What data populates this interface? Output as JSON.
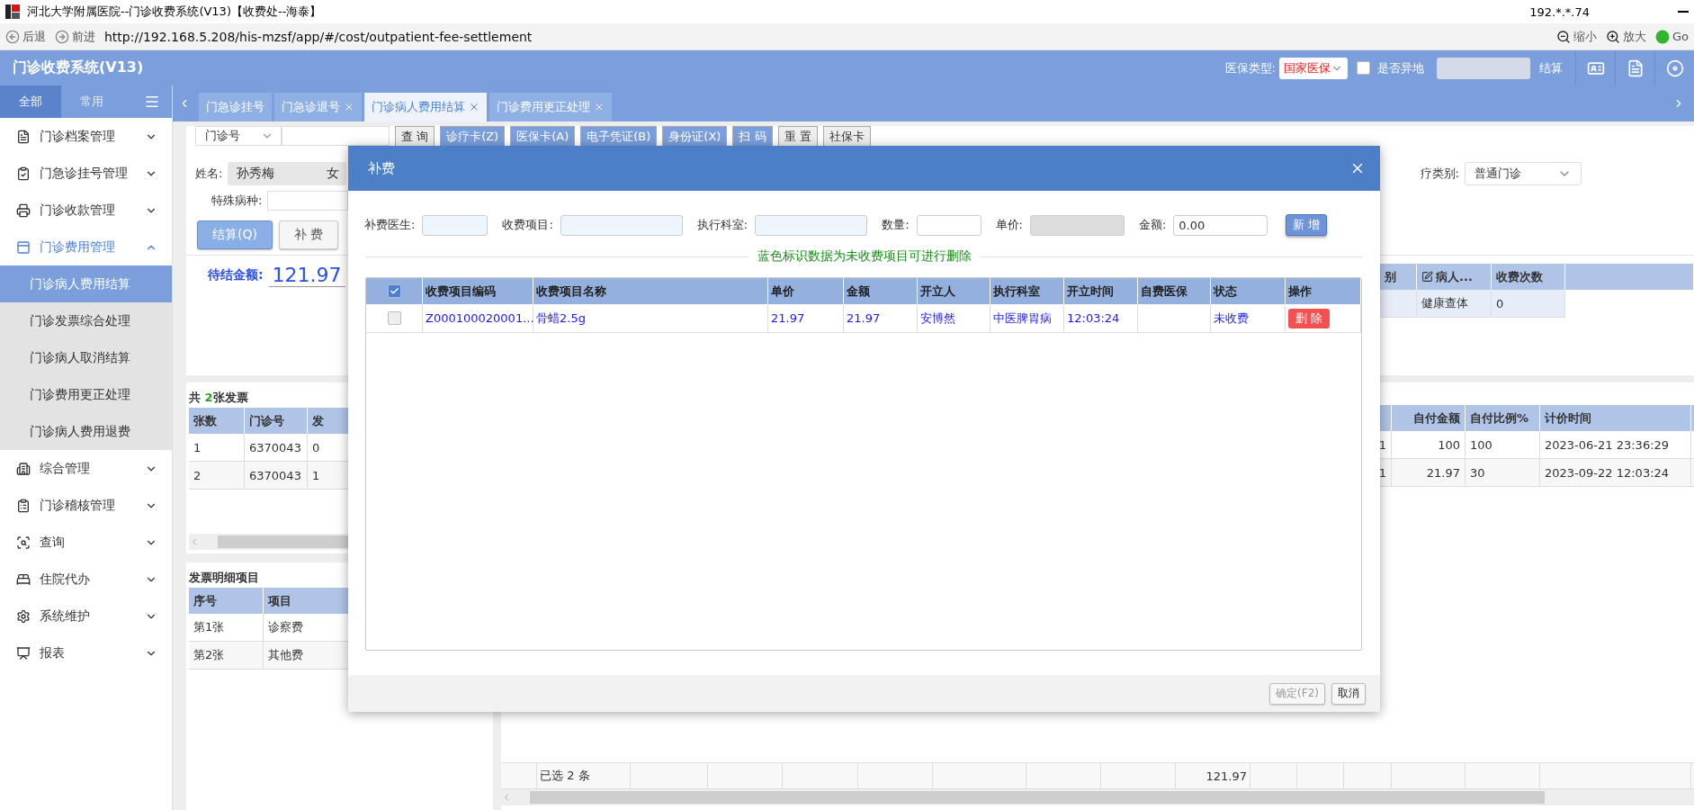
{
  "window": {
    "title": "河北大学附属医院--门诊收费系统(V13)【收费处--海泰】",
    "ip": "192.*.*.74"
  },
  "browser": {
    "back": "后退",
    "forward": "前进",
    "url": "http://192.168.5.208/his-mzsf/app/#/cost/outpatient-fee-settlement",
    "zoom_out": "缩小",
    "zoom_in": "放大",
    "go": "Go"
  },
  "app_header": {
    "title": "门诊收费系统(V13)",
    "insurance_label": "医保类型:",
    "insurance_value": "国家医保",
    "remote_label": "是否异地",
    "remote_checked": false,
    "settle": "结算"
  },
  "sidebar": {
    "tabs": [
      {
        "label": "全部",
        "selected": true
      },
      {
        "label": "常用",
        "selected": false
      }
    ],
    "items": [
      {
        "label": "门诊档案管理",
        "expanded": false
      },
      {
        "label": "门急诊挂号管理",
        "expanded": false
      },
      {
        "label": "门诊收款管理",
        "expanded": false
      },
      {
        "label": "门诊费用管理",
        "expanded": true,
        "children": [
          {
            "label": "门诊病人费用结算",
            "selected": true
          },
          {
            "label": "门诊发票综合处理",
            "selected": false
          },
          {
            "label": "门诊病人取消结算",
            "selected": false
          },
          {
            "label": "门诊费用更正处理",
            "selected": false
          },
          {
            "label": "门诊病人费用退费",
            "selected": false
          }
        ]
      },
      {
        "label": "综合管理",
        "expanded": false
      },
      {
        "label": "门诊稽核管理",
        "expanded": false
      },
      {
        "label": "查询",
        "expanded": false
      },
      {
        "label": "住院代办",
        "expanded": false
      },
      {
        "label": "系统维护",
        "expanded": false
      },
      {
        "label": "报表",
        "expanded": false
      }
    ]
  },
  "tabs": [
    {
      "label": "门急诊挂号",
      "selected": false,
      "closable": false
    },
    {
      "label": "门急诊退号",
      "selected": false,
      "closable": true
    },
    {
      "label": "门诊病人费用结算",
      "selected": true,
      "closable": true
    },
    {
      "label": "门诊费用更正处理",
      "selected": false,
      "closable": true
    }
  ],
  "search": {
    "type": "门诊号",
    "buttons": [
      "查 询",
      "诊疗卡(Z)",
      "医保卡(A)",
      "电子凭证(B)",
      "身份证(X)",
      "扫 码",
      "重 置"
    ],
    "card": "社保卡"
  },
  "patient": {
    "name_label": "姓名:",
    "name": "孙秀梅",
    "sex": "女",
    "disease_label": "特殊病种:",
    "visit_type_label": "疗类别:",
    "visit_type": "普通门诊"
  },
  "actions": [
    {
      "label": "结算(Q)",
      "primary": true
    },
    {
      "label": "补 费",
      "primary": false
    }
  ],
  "pending": {
    "label": "待结金额:",
    "amount": "121.97"
  },
  "visit_table": {
    "columns": [
      "别",
      "病人...",
      "收费次数"
    ],
    "rows": [
      [
        "",
        "健康查体",
        "0"
      ]
    ]
  },
  "invoices": {
    "title_prefix": "共 ",
    "count": "2",
    "title_suffix": "张发票",
    "columns": [
      "张数",
      "门诊号",
      "发"
    ],
    "rows": [
      [
        "1",
        "6370043",
        "0"
      ],
      [
        "2",
        "6370043",
        "1"
      ]
    ]
  },
  "invoice_items": {
    "title": "发票明细项目",
    "columns": [
      "序号",
      "项目"
    ],
    "rows": [
      [
        "第1张",
        "诊察费"
      ],
      [
        "第2张",
        "其他费"
      ]
    ]
  },
  "fee_table": {
    "columns": [
      "",
      "自付金额",
      "自付比例%",
      "计价时间"
    ],
    "rows": [
      [
        "1",
        "100",
        "100",
        "2023-06-21 23:36:29"
      ],
      [
        "1",
        "21.97",
        "30",
        "2023-09-22 12:03:24"
      ]
    ],
    "selected_count": "已选 2 条",
    "total": "121.97"
  },
  "dialog": {
    "title": "补费",
    "fields": [
      {
        "label": "补费医生:",
        "kind": "lookup"
      },
      {
        "label": "收费项目:",
        "kind": "lookup"
      },
      {
        "label": "执行科室:",
        "kind": "lookup"
      },
      {
        "label": "数量:",
        "kind": "input"
      },
      {
        "label": "单价:",
        "kind": "readonly"
      },
      {
        "label": "金额:",
        "kind": "input",
        "value": "0.00"
      }
    ],
    "add_button": "新 增",
    "notice": "蓝色标识数据为未收费项目可进行删除",
    "all_checked": true,
    "columns": [
      "收费项目编码",
      "收费项目名称",
      "单价",
      "金额",
      "开立人",
      "执行科室",
      "开立时间",
      "自费医保",
      "状态",
      "操作"
    ],
    "rows": [
      {
        "checked": false,
        "unpaid": true,
        "cells": [
          "Z000100020001...",
          "骨蜡2.5g",
          "21.97",
          "21.97",
          "安博然",
          "中医脾胃病",
          "12:03:24",
          "",
          "未收费"
        ],
        "action": "删 除"
      }
    ],
    "buttons": [
      {
        "label": "确定(F2)",
        "disabled": true
      },
      {
        "label": "取消",
        "disabled": false
      }
    ]
  }
}
